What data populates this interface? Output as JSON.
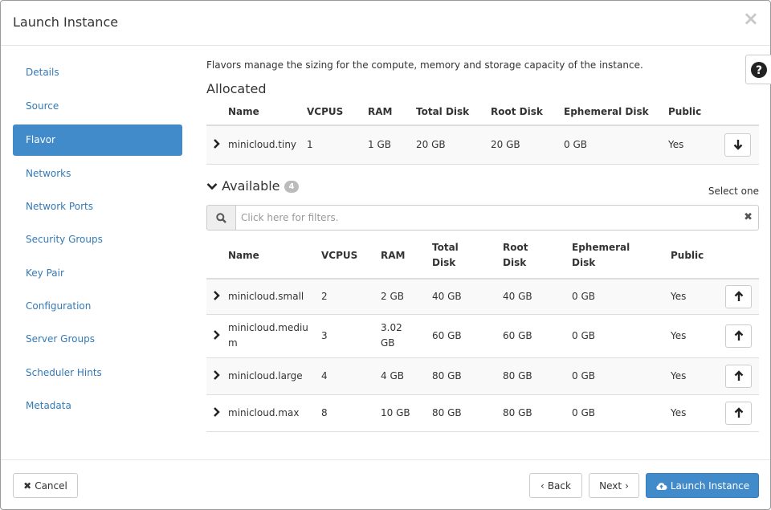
{
  "modal": {
    "title": "Launch Instance",
    "close_label": "×"
  },
  "sidebar": {
    "items": [
      {
        "label": "Details"
      },
      {
        "label": "Source"
      },
      {
        "label": "Flavor"
      },
      {
        "label": "Networks"
      },
      {
        "label": "Network Ports"
      },
      {
        "label": "Security Groups"
      },
      {
        "label": "Key Pair"
      },
      {
        "label": "Configuration"
      },
      {
        "label": "Server Groups"
      },
      {
        "label": "Scheduler Hints"
      },
      {
        "label": "Metadata"
      }
    ],
    "active_index": 2
  },
  "content": {
    "description": "Flavors manage the sizing for the compute, memory and storage capacity of the instance.",
    "allocated": {
      "title": "Allocated",
      "headers": [
        "Name",
        "VCPUS",
        "RAM",
        "Total Disk",
        "Root Disk",
        "Ephemeral Disk",
        "Public"
      ],
      "rows": [
        {
          "name": "minicloud.tiny",
          "vcpus": "1",
          "ram": "1 GB",
          "total_disk": "20 GB",
          "root_disk": "20 GB",
          "ephemeral": "0 GB",
          "public": "Yes"
        }
      ]
    },
    "available": {
      "title": "Available",
      "count": "4",
      "select_label": "Select one",
      "filter_placeholder": "Click here for filters.",
      "headers": {
        "name": "Name",
        "vcpus": "VCPUS",
        "ram": "RAM",
        "total_disk_1": "Total",
        "total_disk_2": "Disk",
        "root_disk_1": "Root",
        "root_disk_2": "Disk",
        "ephemeral_1": "Ephemeral",
        "ephemeral_2": "Disk",
        "public": "Public"
      },
      "rows": [
        {
          "name_1": "minicloud.small",
          "name_2": "",
          "vcpus": "2",
          "ram_1": "2 GB",
          "ram_2": "",
          "total_disk": "40 GB",
          "root_disk": "40 GB",
          "ephemeral": "0 GB",
          "public": "Yes"
        },
        {
          "name_1": "minicloud.mediu",
          "name_2": "m",
          "vcpus": "3",
          "ram_1": "3.02",
          "ram_2": "GB",
          "total_disk": "60 GB",
          "root_disk": "60 GB",
          "ephemeral": "0 GB",
          "public": "Yes"
        },
        {
          "name_1": "minicloud.large",
          "name_2": "",
          "vcpus": "4",
          "ram_1": "4 GB",
          "ram_2": "",
          "total_disk": "80 GB",
          "root_disk": "80 GB",
          "ephemeral": "0 GB",
          "public": "Yes"
        },
        {
          "name_1": "minicloud.max",
          "name_2": "",
          "vcpus": "8",
          "ram_1": "10 GB",
          "ram_2": "",
          "total_disk": "80 GB",
          "root_disk": "80 GB",
          "ephemeral": "0 GB",
          "public": "Yes"
        }
      ]
    }
  },
  "footer": {
    "cancel_label": "Cancel",
    "back_label": "Back",
    "next_label": "Next",
    "launch_label": "Launch Instance"
  },
  "colors": {
    "primary": "#428bca",
    "link": "#337ab7"
  }
}
